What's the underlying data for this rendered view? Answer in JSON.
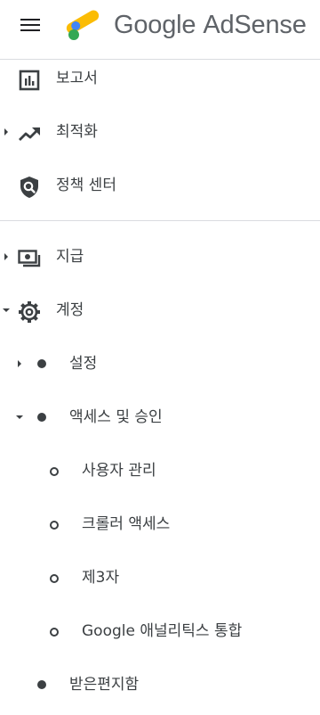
{
  "header": {
    "brand_google": "Google",
    "brand_product": "AdSense",
    "logo_colors": {
      "yellow": "#FBBC04",
      "blue": "#4285F4",
      "green": "#34A853"
    }
  },
  "nav": {
    "reports": {
      "label": "보고서",
      "icon": "bar-chart-icon"
    },
    "optimization": {
      "label": "최적화",
      "icon": "trending-up-icon"
    },
    "policy_center": {
      "label": "정책 센터",
      "icon": "shield-search-icon"
    },
    "payments": {
      "label": "지급",
      "icon": "payments-icon"
    },
    "account": {
      "label": "계정",
      "icon": "gear-icon",
      "settings": {
        "label": "설정"
      },
      "access": {
        "label": "액세스 및 승인",
        "items": [
          {
            "label": "사용자 관리"
          },
          {
            "label": "크롤러 액세스"
          },
          {
            "label": "제3자"
          },
          {
            "label": "Google 애널리틱스 통합"
          }
        ]
      },
      "inbox": {
        "label": "받은편지함"
      }
    }
  },
  "colors": {
    "text": "#3c4043",
    "divider": "#dadce0"
  }
}
